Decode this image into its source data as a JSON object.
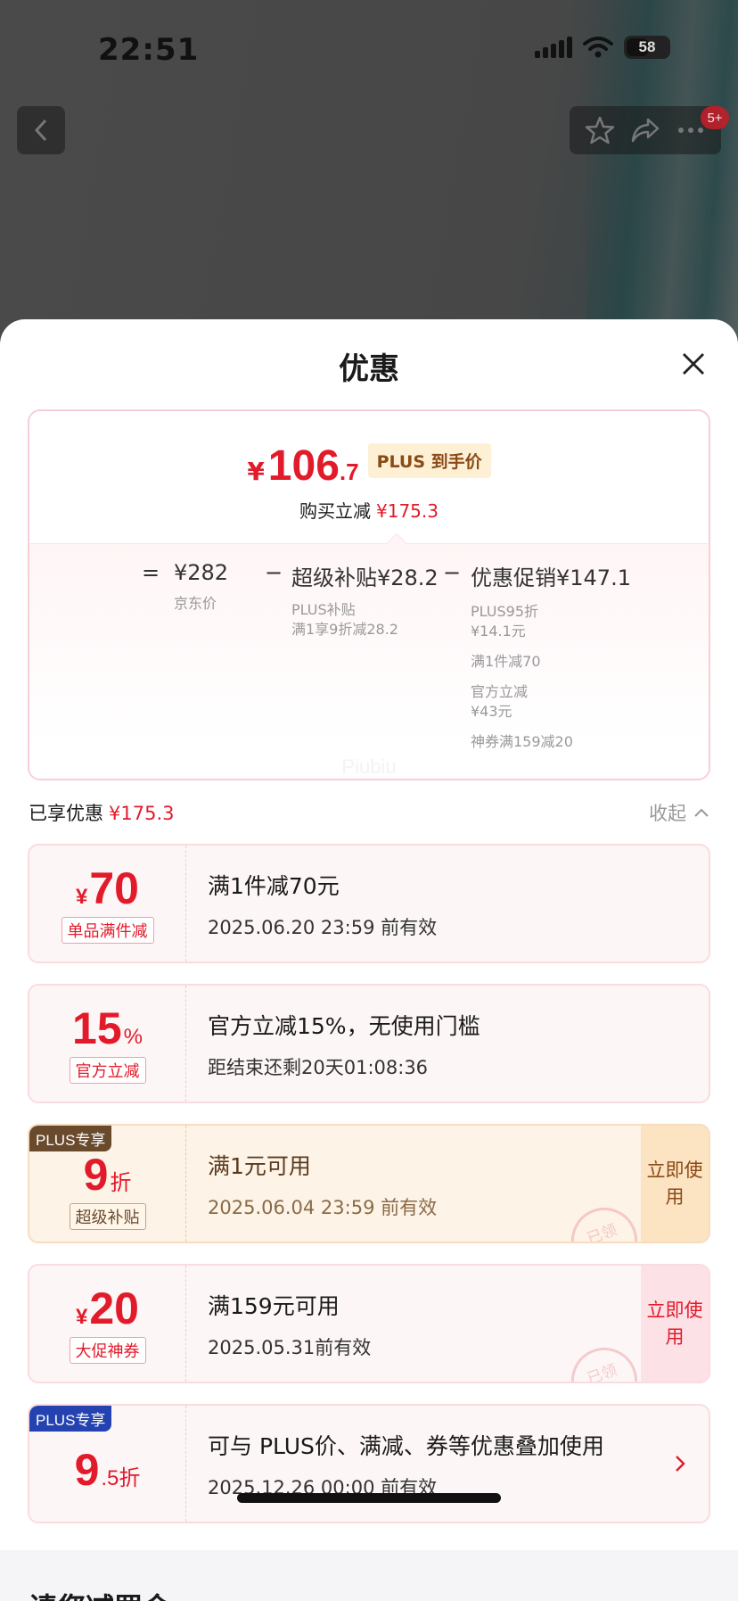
{
  "status_bar": {
    "time": "22:51",
    "battery": "58"
  },
  "nav": {
    "cart_badge": "5+"
  },
  "sheet": {
    "title": "优惠",
    "price_summary": {
      "currency": "¥",
      "price_int": "106",
      "price_dec": ".7",
      "price_tag": "PLUS 到手价",
      "save_label": "购买立减",
      "save_value": "¥175.3",
      "formula": {
        "equals": "=",
        "minus": "−",
        "base_value": "¥282",
        "base_label": "京东价",
        "subsidy_title": "超级补贴¥28.2",
        "subsidy_detail_1": "PLUS补贴",
        "subsidy_detail_2": "满1享9折减28.2",
        "promo_title": "优惠促销¥147.1",
        "promo_items": [
          "PLUS95折 ¥14.1元",
          "满1件减70",
          "官方立减 ¥43元",
          "神券满159减20"
        ]
      },
      "watermark": "Piubiu"
    },
    "enjoyed": {
      "label": "已享优惠",
      "value": "¥175.3",
      "collapse_label": "收起"
    },
    "coupons": [
      {
        "sym": "¥",
        "num": "70",
        "unit": "",
        "tag": "单品满件减",
        "title": "满1件减70元",
        "sub": "2025.06.20 23:59 前有效"
      },
      {
        "sym": "",
        "num": "15",
        "unit": "%",
        "tag": "官方立减",
        "title": "官方立减15%，无使用门槛",
        "sub": "距结束还剩20天01:08:36"
      },
      {
        "corner": "PLUS专享",
        "sym": "",
        "num": "9",
        "unit": "折",
        "tag": "超级补贴",
        "title": "满1元可用",
        "sub": "2025.06.04 23:59 前有效",
        "action": "立即使用",
        "stamp": "已领"
      },
      {
        "sym": "¥",
        "num": "20",
        "unit": "",
        "tag": "大促神券",
        "title": "满159元可用",
        "sub": "2025.05.31前有效",
        "action": "立即使用",
        "stamp": "已领"
      },
      {
        "corner": "PLUS专享",
        "sym": "",
        "num": "9",
        "unit": ".5折",
        "title": "可与 PLUS价、满减、券等优惠叠加使用",
        "sub": "2025.12.26 00:00 前有效"
      }
    ],
    "partial_footer_text": "请您减罚金"
  },
  "colors": {
    "accent_red": "#e21b2b",
    "plus_gold": "#8a4a16",
    "plus_blue": "#2443b0"
  }
}
